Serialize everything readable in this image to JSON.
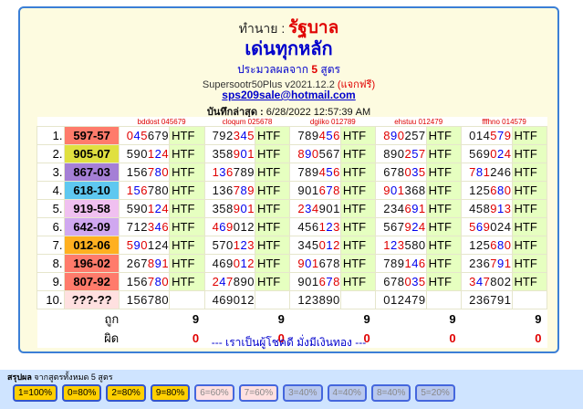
{
  "header": {
    "title_prefix": "ทำนาย :",
    "title_big": "รัฐบาล",
    "subtitle": "เด่นทุกหลัก",
    "line3_a": "ประมวลผลจาก",
    "line3_num": "5",
    "line3_b": "สูตร",
    "version": "Supersootr50Plus v2021.12.2",
    "free": "(แจกฟรี)",
    "email": "sps209sale@hotmail.com",
    "last_saved_label": "บันทึกล่าสุด :",
    "last_saved_value": "6/28/2022 12:57:39 AM"
  },
  "col_headers": [
    "bddost 045679",
    "cloqum 025678",
    "dgiiko 012789",
    "ehstuu 012479",
    "fffhno 014579"
  ],
  "rows": [
    {
      "i": "1.",
      "pair": "597-57",
      "bg": "#ff7b6b",
      "cells": [
        "045679",
        "792345",
        "789456",
        "890257",
        "014579"
      ]
    },
    {
      "i": "2.",
      "pair": "905-07",
      "bg": "#e0e040",
      "cells": [
        "590124",
        "358901",
        "890567",
        "890257",
        "569024"
      ]
    },
    {
      "i": "3.",
      "pair": "867-03",
      "bg": "#a57fd6",
      "cells": [
        "156780",
        "136789",
        "789456",
        "678035",
        "781246"
      ]
    },
    {
      "i": "4.",
      "pair": "618-10",
      "bg": "#5ec8f0",
      "cells": [
        "156780",
        "136789",
        "901678",
        "901368",
        "125680"
      ]
    },
    {
      "i": "5.",
      "pair": "919-58",
      "bg": "#f0c0f0",
      "cells": [
        "590124",
        "358901",
        "234901",
        "234691",
        "458913"
      ]
    },
    {
      "i": "6.",
      "pair": "642-09",
      "bg": "#d0a8f0",
      "cells": [
        "712346",
        "469012",
        "456123",
        "567924",
        "569024"
      ]
    },
    {
      "i": "7.",
      "pair": "012-06",
      "bg": "#ffb020",
      "cells": [
        "590124",
        "570123",
        "345012",
        "123580",
        "125680"
      ]
    },
    {
      "i": "8.",
      "pair": "196-02",
      "bg": "#ff7b6b",
      "cells": [
        "267891",
        "469012",
        "901678",
        "789146",
        "236791"
      ]
    },
    {
      "i": "9.",
      "pair": "807-92",
      "bg": "#ff7b6b",
      "cells": [
        "156780",
        "247890",
        "901678",
        "678035",
        "347802"
      ]
    },
    {
      "i": "10.",
      "pair": "???-??",
      "bg": "#ffe0e0",
      "cells": [
        "156780",
        "469012",
        "123890",
        "012479",
        "236791"
      ]
    }
  ],
  "htf": "HTF",
  "summary": {
    "right_label": "ถูก",
    "wrong_label": "ผิด",
    "right": [
      "9",
      "9",
      "9",
      "9",
      "9"
    ],
    "wrong": [
      "0",
      "0",
      "0",
      "0",
      "0"
    ]
  },
  "footer": "--- เราเป็นผู้โชคดี มั่งมีเงินทอง ---",
  "bottom": {
    "caption_bold": "สรุปผล",
    "caption": "จากสูตรทั้งหมด 5 สูตร",
    "badges": [
      "1=100%",
      "0=80%",
      "2=80%",
      "9=80%",
      "6=60%",
      "7=60%",
      "3=40%",
      "4=40%",
      "8=40%",
      "5=20%"
    ]
  }
}
